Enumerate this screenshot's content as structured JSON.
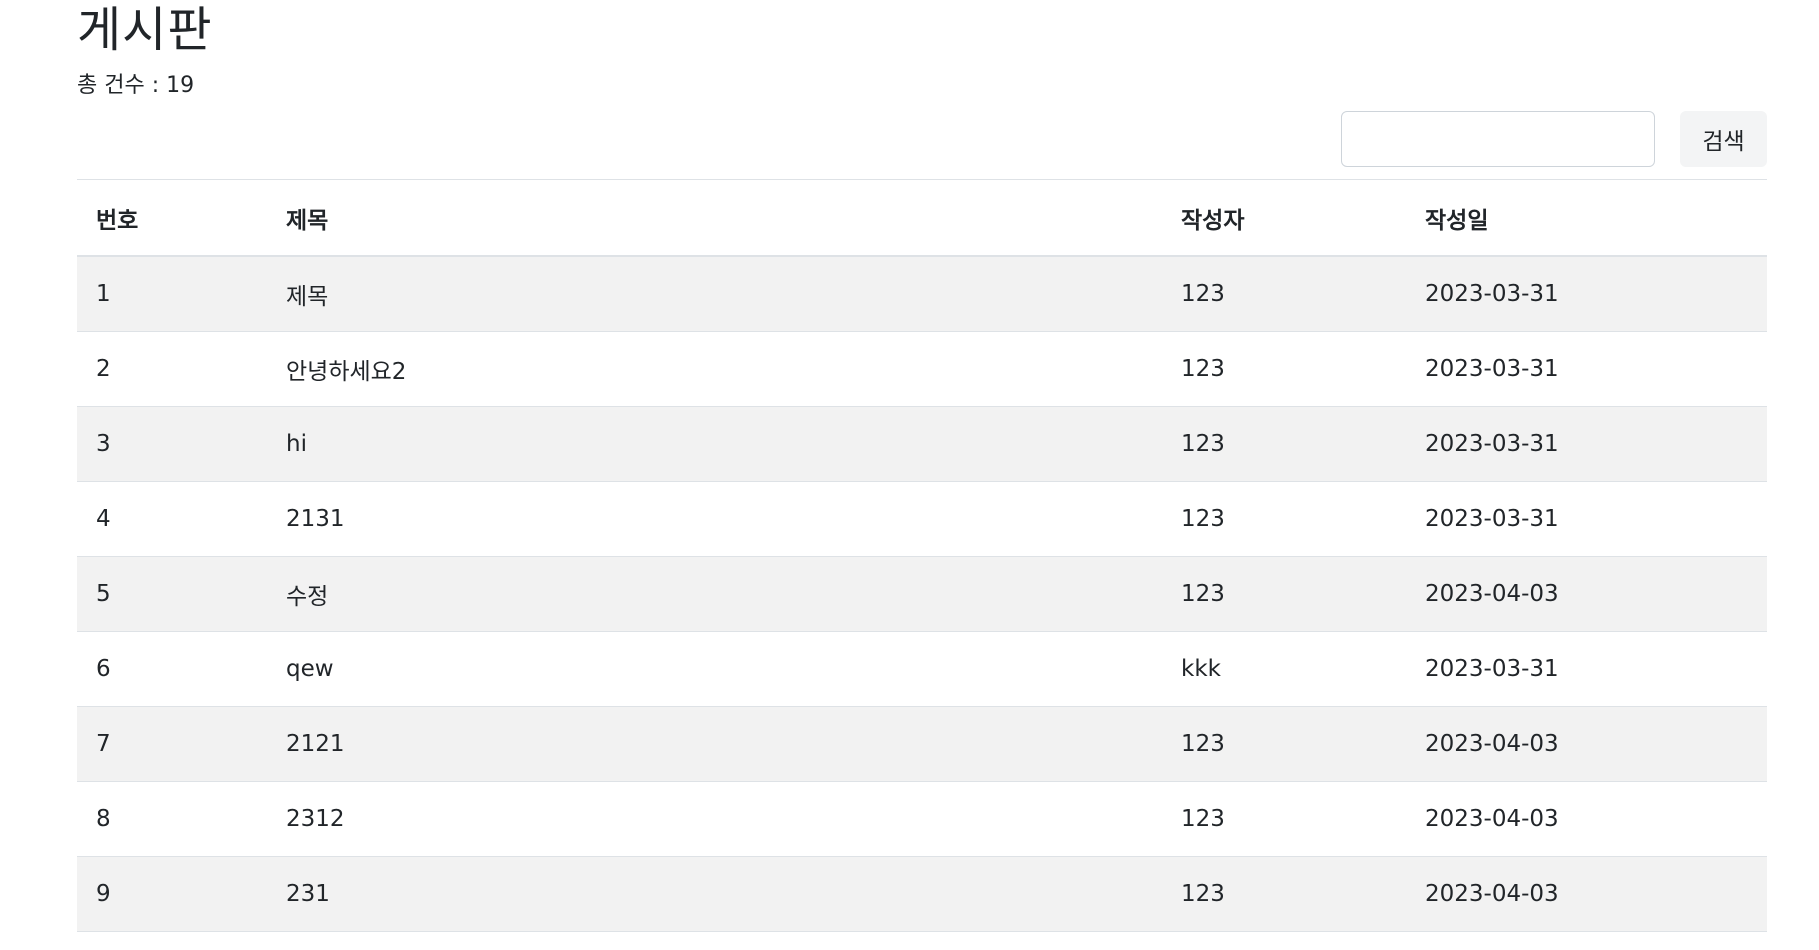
{
  "header": {
    "title": "게시판",
    "total_label": "총 건수 : 19"
  },
  "search": {
    "value": "",
    "placeholder": "",
    "button_label": "검색"
  },
  "table": {
    "columns": [
      "번호",
      "제목",
      "작성자",
      "작성일"
    ],
    "rows": [
      {
        "no": "1",
        "title": "제목",
        "author": "123",
        "date": "2023-03-31"
      },
      {
        "no": "2",
        "title": "안녕하세요2",
        "author": "123",
        "date": "2023-03-31"
      },
      {
        "no": "3",
        "title": "hi",
        "author": "123",
        "date": "2023-03-31"
      },
      {
        "no": "4",
        "title": "2131",
        "author": "123",
        "date": "2023-03-31"
      },
      {
        "no": "5",
        "title": "수정",
        "author": "123",
        "date": "2023-04-03"
      },
      {
        "no": "6",
        "title": "qew",
        "author": "kkk",
        "date": "2023-03-31"
      },
      {
        "no": "7",
        "title": "2121",
        "author": "123",
        "date": "2023-04-03"
      },
      {
        "no": "8",
        "title": "2312",
        "author": "123",
        "date": "2023-04-03"
      },
      {
        "no": "9",
        "title": "231",
        "author": "123",
        "date": "2023-04-03"
      }
    ]
  }
}
